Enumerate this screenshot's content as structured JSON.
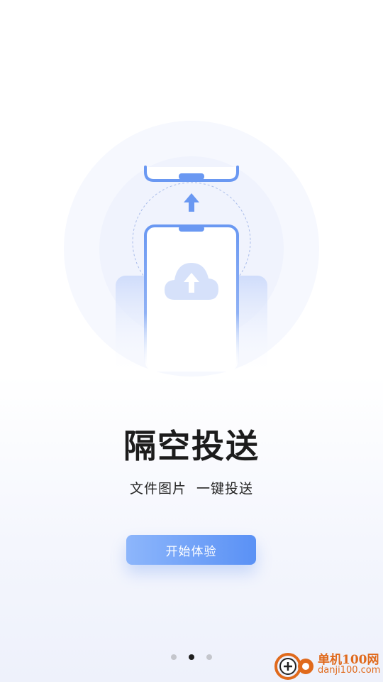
{
  "onboarding": {
    "title": "隔空投送",
    "subtitle": "文件图片  一键投送",
    "start_button_label": "开始体验",
    "page_indicator": {
      "total": 3,
      "current": 2
    }
  },
  "illustration": {
    "icons": [
      "phone-icon",
      "cloud-upload-icon",
      "arrow-up-icon"
    ],
    "accent_color": "#5a91f5"
  },
  "watermark": {
    "brand": "单机100网",
    "url": "danji100.com",
    "color": "#e06a1c"
  }
}
